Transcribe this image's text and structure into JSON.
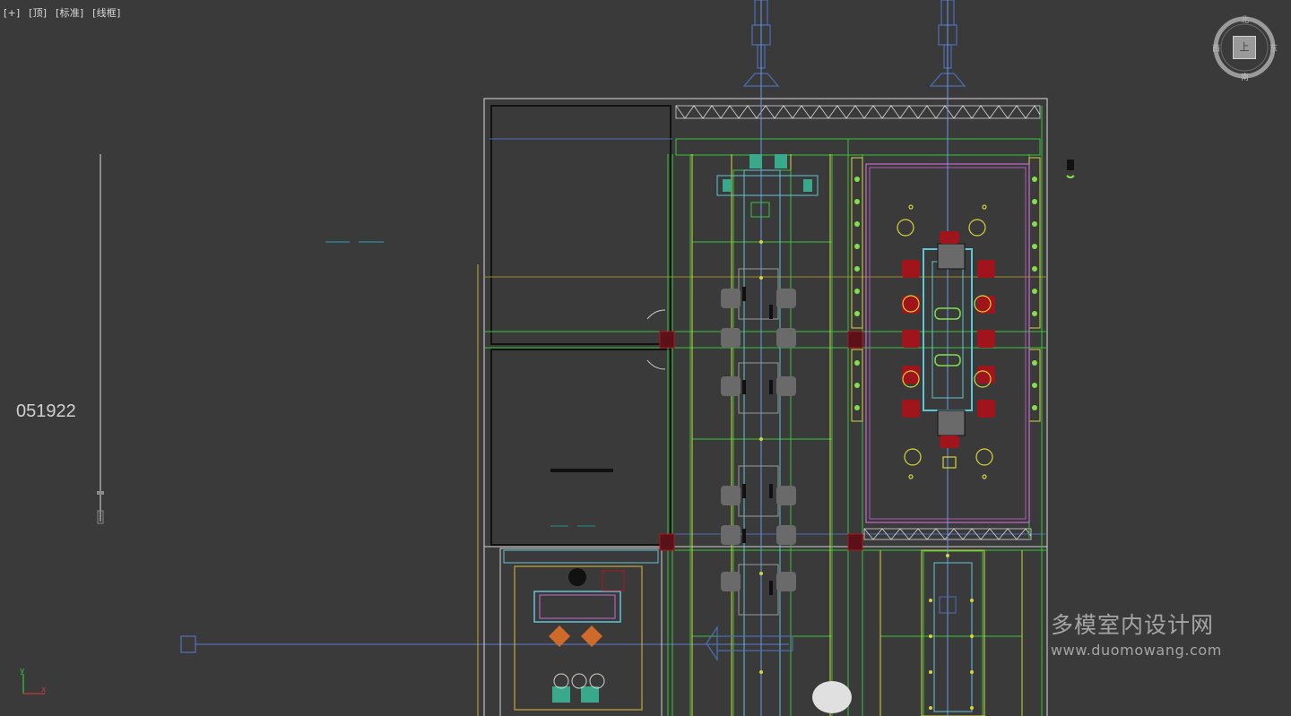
{
  "viewport": {
    "labels": [
      "[+]",
      "[顶]",
      "[标准]",
      "[线框]"
    ],
    "side_number": "051922"
  },
  "viewcube": {
    "face": "上",
    "north": "北",
    "south": "南",
    "east": "东",
    "west": "西"
  },
  "watermark": {
    "cn": "多模室内设计网",
    "en": "www.duomowang.com"
  },
  "axes": {
    "y": "y",
    "x": "x"
  },
  "colors": {
    "background": "#3a3a3a",
    "green": "#37c43a",
    "yellow": "#d8d43a",
    "magenta": "#c86ad0",
    "cyan": "#5fc6d6",
    "red": "#b0141c",
    "blue": "#4a6ec8",
    "white": "#dcdcdc"
  }
}
